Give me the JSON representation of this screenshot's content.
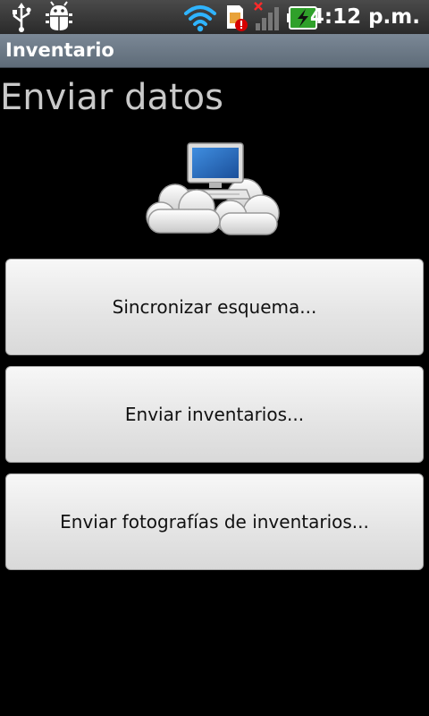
{
  "status_bar": {
    "time": "4:12 p.m.",
    "icons": [
      "usb-icon",
      "debug-icon",
      "wifi-icon",
      "sim-alert-icon",
      "no-signal-icon",
      "battery-charging-icon"
    ]
  },
  "app": {
    "title": "Inventario"
  },
  "page": {
    "heading": "Enviar datos",
    "illustration": "computer-cloud-icon"
  },
  "actions": {
    "sync_schema": "Sincronizar esquema...",
    "send_inventories": "Enviar inventarios...",
    "send_photos": "Enviar fotografías de inventarios..."
  },
  "colors": {
    "background": "#000000",
    "title_bar": "#6b7885",
    "button_face": "#e8e8e8",
    "battery_green": "#2fa02a"
  }
}
